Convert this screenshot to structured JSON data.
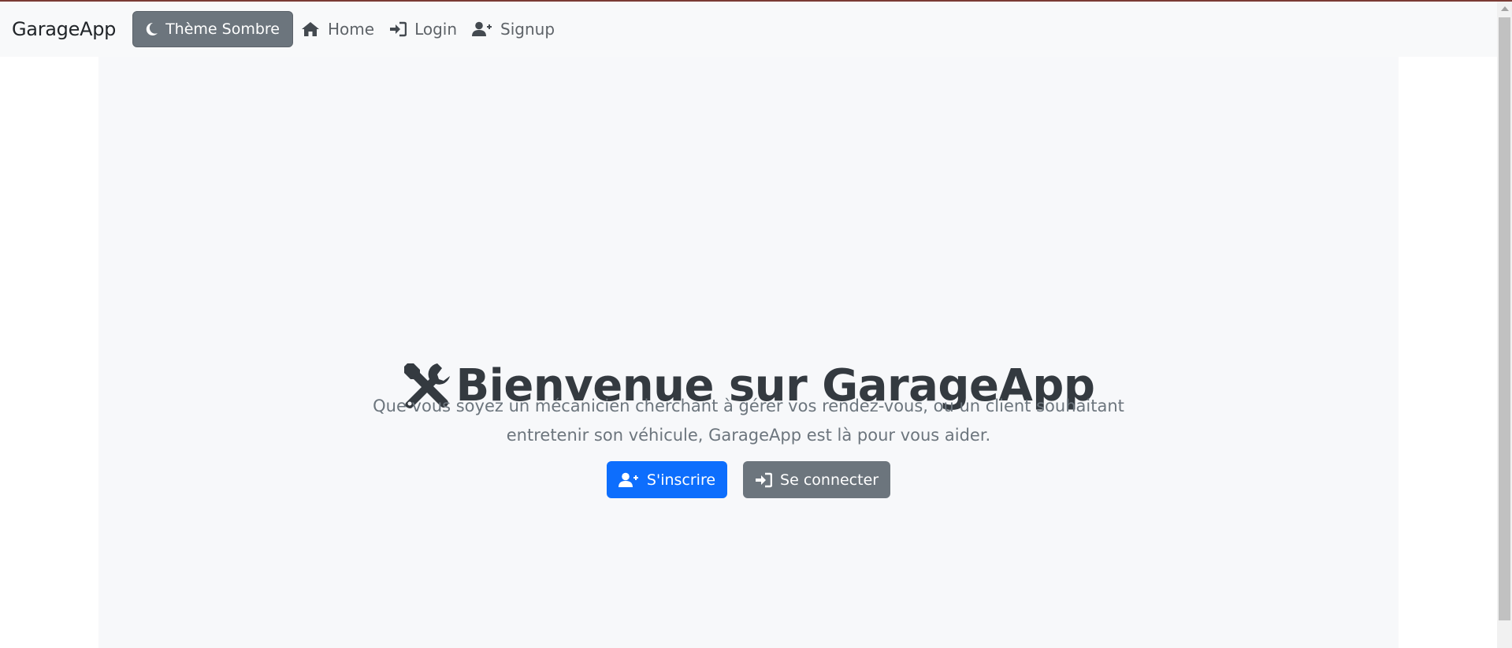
{
  "navbar": {
    "brand": "GarageApp",
    "theme_button": {
      "label": "Thème Sombre",
      "icon": "moon-icon"
    },
    "links": [
      {
        "label": "Home",
        "icon": "home-icon"
      },
      {
        "label": "Login",
        "icon": "sign-in-icon"
      },
      {
        "label": "Signup",
        "icon": "user-plus-icon"
      }
    ]
  },
  "hero": {
    "icon": "tools-icon",
    "title": "Bienvenue sur GarageApp",
    "subtitle_line1": "Que vous soyez un mécanicien cherchant à gérer vos rendez-vous, ou un client souhaitant",
    "subtitle_line2": "entretenir son véhicule, GarageApp est là pour vous aider.",
    "signup_button": {
      "label": "S'inscrire",
      "icon": "user-plus-icon"
    },
    "login_button": {
      "label": "Se connecter",
      "icon": "sign-in-icon"
    }
  },
  "colors": {
    "primary": "#0d6efd",
    "secondary": "#6c757d",
    "navbar_bg": "#f8f9fa",
    "title": "#343a40"
  }
}
